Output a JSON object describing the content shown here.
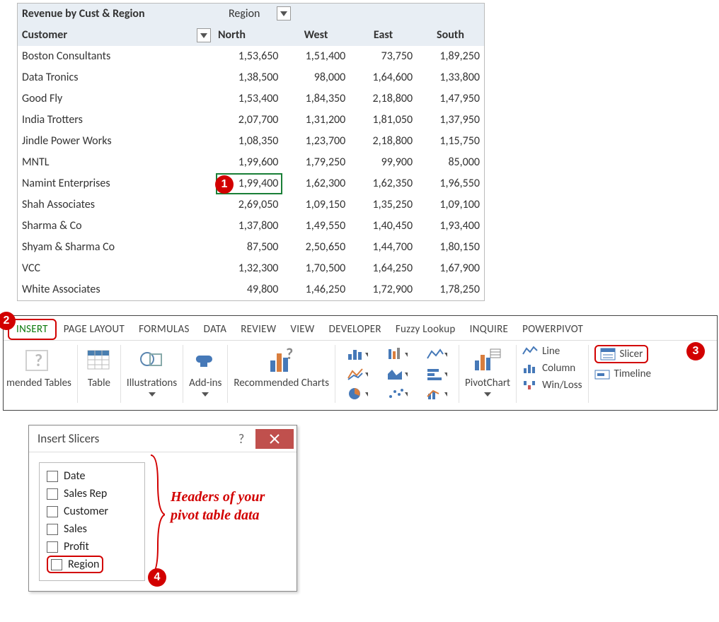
{
  "pivot": {
    "title": "Revenue by Cust & Region",
    "region_label": "Region",
    "row_field_label": "Customer",
    "columns": [
      "North",
      "West",
      "East",
      "South"
    ],
    "rows": [
      {
        "name": "Boston Consultants",
        "vals": [
          "1,53,650",
          "1,51,400",
          "73,750",
          "1,89,250"
        ]
      },
      {
        "name": "Data Tronics",
        "vals": [
          "1,38,500",
          "98,000",
          "1,64,600",
          "1,33,800"
        ]
      },
      {
        "name": "Good Fly",
        "vals": [
          "1,53,400",
          "1,84,350",
          "2,18,800",
          "1,47,950"
        ]
      },
      {
        "name": "India Trotters",
        "vals": [
          "2,07,700",
          "1,31,200",
          "1,81,050",
          "1,37,950"
        ]
      },
      {
        "name": "Jindle Power Works",
        "vals": [
          "1,08,350",
          "1,23,700",
          "2,18,800",
          "1,15,750"
        ]
      },
      {
        "name": "MNTL",
        "vals": [
          "1,99,600",
          "1,79,250",
          "99,900",
          "85,000"
        ]
      },
      {
        "name": "Namint Enterprises",
        "vals": [
          "1,99,400",
          "1,62,300",
          "1,62,350",
          "1,96,550"
        ]
      },
      {
        "name": "Shah Associates",
        "vals": [
          "2,69,050",
          "1,09,150",
          "1,35,250",
          "1,09,100"
        ]
      },
      {
        "name": "Sharma & Co",
        "vals": [
          "1,37,800",
          "1,49,550",
          "1,40,450",
          "1,93,400"
        ]
      },
      {
        "name": "Shyam & Sharma Co",
        "vals": [
          "87,500",
          "2,50,650",
          "1,44,700",
          "1,80,150"
        ]
      },
      {
        "name": "VCC",
        "vals": [
          "1,32,300",
          "1,70,500",
          "1,64,250",
          "1,67,900"
        ]
      },
      {
        "name": "White Associates",
        "vals": [
          "49,800",
          "1,46,250",
          "1,72,900",
          "1,78,250"
        ]
      }
    ],
    "selected": {
      "rowIndex": 6,
      "colIndex": 0
    }
  },
  "ribbon": {
    "tabs": [
      "INSERT",
      "PAGE LAYOUT",
      "FORMULAS",
      "DATA",
      "REVIEW",
      "VIEW",
      "DEVELOPER",
      "Fuzzy Lookup",
      "INQUIRE",
      "POWERPIVOT"
    ],
    "active_tab_index": 0,
    "groups": {
      "reco_tables": "mended Tables",
      "table": "Table",
      "illustrations": "Illustrations",
      "addins": "Add-ins",
      "reco_charts": "Recommended Charts",
      "pivotchart": "PivotChart",
      "sparklines": {
        "line": "Line",
        "column": "Column",
        "winloss": "Win/Loss"
      },
      "slicer": "Slicer",
      "timeline": "Timeline"
    }
  },
  "dialog": {
    "title": "Insert Slicers",
    "fields": [
      "Date",
      "Sales Rep",
      "Customer",
      "Sales",
      "Profit",
      "Region"
    ],
    "annotation": "Headers of your pivot table data"
  },
  "callouts": {
    "c1": "1",
    "c2": "2",
    "c3": "3",
    "c4": "4"
  },
  "chart_data": {
    "type": "table",
    "title": "Revenue by Cust & Region",
    "row_label": "Customer",
    "col_label": "Region",
    "columns": [
      "North",
      "West",
      "East",
      "South"
    ],
    "rows": [
      "Boston Consultants",
      "Data Tronics",
      "Good Fly",
      "India Trotters",
      "Jindle Power Works",
      "MNTL",
      "Namint Enterprises",
      "Shah Associates",
      "Sharma & Co",
      "Shyam & Sharma Co",
      "VCC",
      "White Associates"
    ],
    "values": [
      [
        153650,
        151400,
        73750,
        189250
      ],
      [
        138500,
        98000,
        164600,
        133800
      ],
      [
        153400,
        184350,
        218800,
        147950
      ],
      [
        207700,
        131200,
        181050,
        137950
      ],
      [
        108350,
        123700,
        218800,
        115750
      ],
      [
        199600,
        179250,
        99900,
        85000
      ],
      [
        199400,
        162300,
        162350,
        196550
      ],
      [
        269050,
        109150,
        135250,
        109100
      ],
      [
        137800,
        149550,
        140450,
        193400
      ],
      [
        87500,
        250650,
        144700,
        180150
      ],
      [
        132300,
        170500,
        164250,
        167900
      ],
      [
        49800,
        146250,
        172900,
        178250
      ]
    ]
  }
}
